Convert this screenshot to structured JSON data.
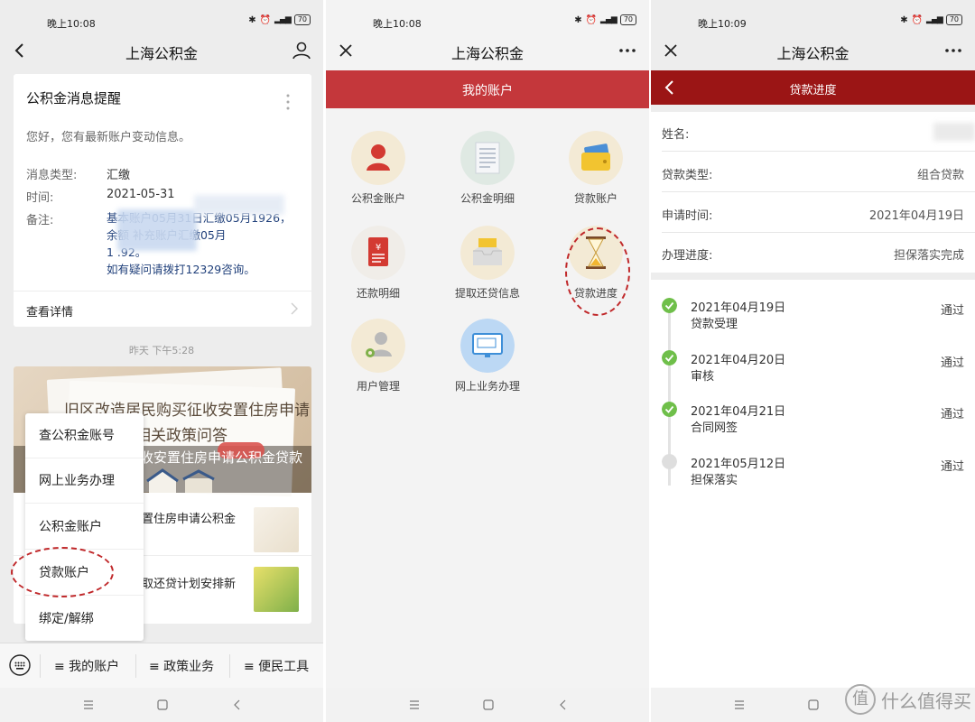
{
  "panel1": {
    "status_time": "晚上10:08",
    "battery": "70",
    "title": "上海公积金",
    "message_card": {
      "title": "公积金消息提醒",
      "greeting": "您好，您有最新账户变动信息。",
      "type_label": "消息类型:",
      "type_value": "汇缴",
      "time_label": "时间:",
      "time_value": "2021-05-31",
      "remark_label": "备注:",
      "remark_line1": "基本账户05月31日汇缴05月1926，",
      "remark_line2": "余额          补充账户汇缴05月",
      "remark_line3": "1           .92。",
      "remark_line4": "如有疑问请拨打12329咨询。",
      "detail_label": "查看详情"
    },
    "timestamp": "昨天 下午5:28",
    "news": {
      "banner_line1": "旧区改造居民购买征收安置住房申请",
      "banner_line2": "款相关政策问答",
      "banner_line3": "收安置住房申请公积金贷款",
      "item1": "置住房申请公积金",
      "item2": "取还贷计划安排新"
    },
    "popup": [
      "查公积金账号",
      "网上业务办理",
      "公积金账户",
      "贷款账户",
      "绑定/解绑"
    ],
    "menu": [
      "≡ 我的账户",
      "≡ 政策业务",
      "≡ 便民工具"
    ]
  },
  "panel2": {
    "status_time": "晚上10:08",
    "battery": "70",
    "title": "上海公积金",
    "header": "我的账户",
    "grid": [
      {
        "label": "公积金账户",
        "icon": "person-icon"
      },
      {
        "label": "公积金明细",
        "icon": "document-list-icon"
      },
      {
        "label": "贷款账户",
        "icon": "wallet-icon"
      },
      {
        "label": "还款明细",
        "icon": "receipt-icon"
      },
      {
        "label": "提取还贷信息",
        "icon": "inbox-icon"
      },
      {
        "label": "贷款进度",
        "icon": "hourglass-icon"
      },
      {
        "label": "用户管理",
        "icon": "user-gear-icon"
      },
      {
        "label": "网上业务办理",
        "icon": "monitor-icon"
      }
    ]
  },
  "panel3": {
    "status_time": "晚上10:09",
    "battery": "70",
    "title": "上海公积金",
    "header": "贷款进度",
    "info": [
      {
        "label": "姓名:",
        "value": ""
      },
      {
        "label": "贷款类型:",
        "value": "组合贷款"
      },
      {
        "label": "申请时间:",
        "value": "2021年04月19日"
      },
      {
        "label": "办理进度:",
        "value": "担保落实完成"
      }
    ],
    "timeline": [
      {
        "date": "2021年04月19日",
        "desc": "贷款受理",
        "status": "通过",
        "done": true
      },
      {
        "date": "2021年04月20日",
        "desc": "审核",
        "status": "通过",
        "done": true
      },
      {
        "date": "2021年04月21日",
        "desc": "合同网签",
        "status": "通过",
        "done": true
      },
      {
        "date": "2021年05月12日",
        "desc": "担保落实",
        "status": "通过",
        "done": false
      }
    ],
    "watermark": "什么值得买"
  },
  "colors": {
    "red_header": "#c4373b",
    "dark_red_header": "#9b1515",
    "check_green": "#6fbf4a",
    "annotation_red": "#c0282a"
  }
}
